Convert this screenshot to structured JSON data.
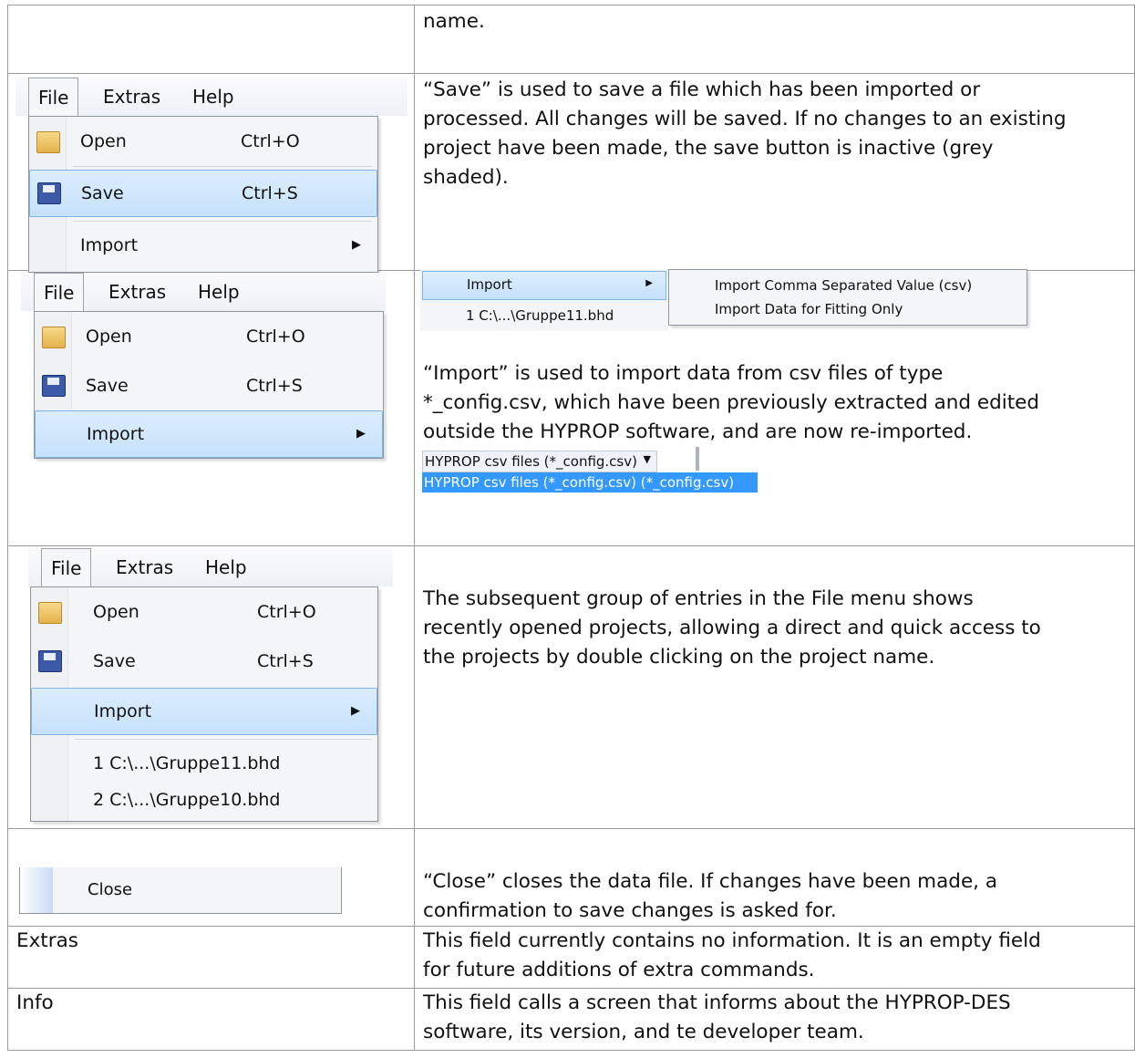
{
  "rows": [
    {
      "left": "",
      "right": "name."
    },
    {
      "right": "“Save” is used to save a file which has been imported or\nprocessed. All changes will be saved. If no changes to an existing\nproject have been made, the save button is inactive (grey\nshaded)."
    },
    {
      "right": "“Import” is used to import data from csv files of type\n*_config.csv, which have been previously extracted and edited\noutside the HYPROP software, and are now re-imported."
    },
    {
      "right": "The subsequent group of entries in the File menu shows\nrecently opened projects, allowing a direct and quick access to\nthe projects by double clicking on the project name."
    },
    {
      "right": "“Close” closes the data file. If changes have been made, a\nconfirmation to save changes is asked for."
    },
    {
      "left": "Extras",
      "right": "This field currently contains no information. It is an empty field\nfor future additions of extra commands."
    },
    {
      "left": "Info",
      "right": "This field calls a screen that informs about the HYPROP-DES\nsoftware, its version, and te developer team."
    }
  ],
  "menu": {
    "bar": [
      "File",
      "Extras",
      "Help"
    ],
    "open": "Open",
    "open_sc": "Ctrl+O",
    "save": "Save",
    "save_sc": "Ctrl+S",
    "import": "Import",
    "recent1": "1 C:\\...\\Gruppe11.bhd",
    "recent2": "2 C:\\...\\Gruppe10.bhd",
    "close": "Close"
  },
  "import_submenu": {
    "parent": "Import",
    "recent": "1 C:\\...\\Gruppe11.bhd",
    "opt1": "Import Comma Separated Value (csv)",
    "opt2": "Import Data for Fitting Only"
  },
  "file_type": {
    "selected": "HYPROP csv files (*_config.csv)",
    "option": "HYPROP csv files (*_config.csv) (*_config.csv)"
  },
  "icons": {
    "open": "folder-open-icon",
    "save": "floppy-disk-icon",
    "submenu": "triangle-right-icon",
    "dropdown": "triangle-down-icon"
  }
}
